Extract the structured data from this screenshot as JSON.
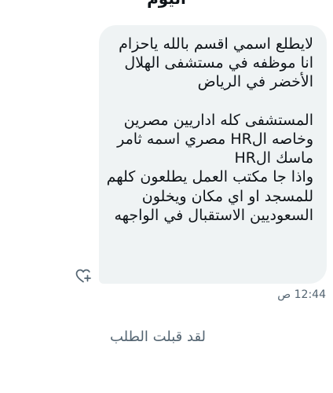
{
  "conversation": {
    "day_label": "اليوم"
  },
  "message": {
    "text": "لايطلع اسمي اقسم بالله ياحزام\nانا موظفه في مستشفى الهلال الأخضر في الرياض\n\nالمستشفى كله اداريين مصرين وخاصه الHR مصري اسمه ثامر ماسك الHR\nواذا جا مكتب العمل يطلعون كلهم للمسجد او اي مكان ويخلون السعوديين الاستقبال في الواجهه",
    "timestamp": "12:44 ص",
    "react_icon": "heart-plus-icon"
  },
  "status": {
    "notice": "لقد قبلت الطلب"
  },
  "colors": {
    "bubble_bg": "#eff3f4",
    "text": "#0f1419",
    "muted": "#536471"
  }
}
